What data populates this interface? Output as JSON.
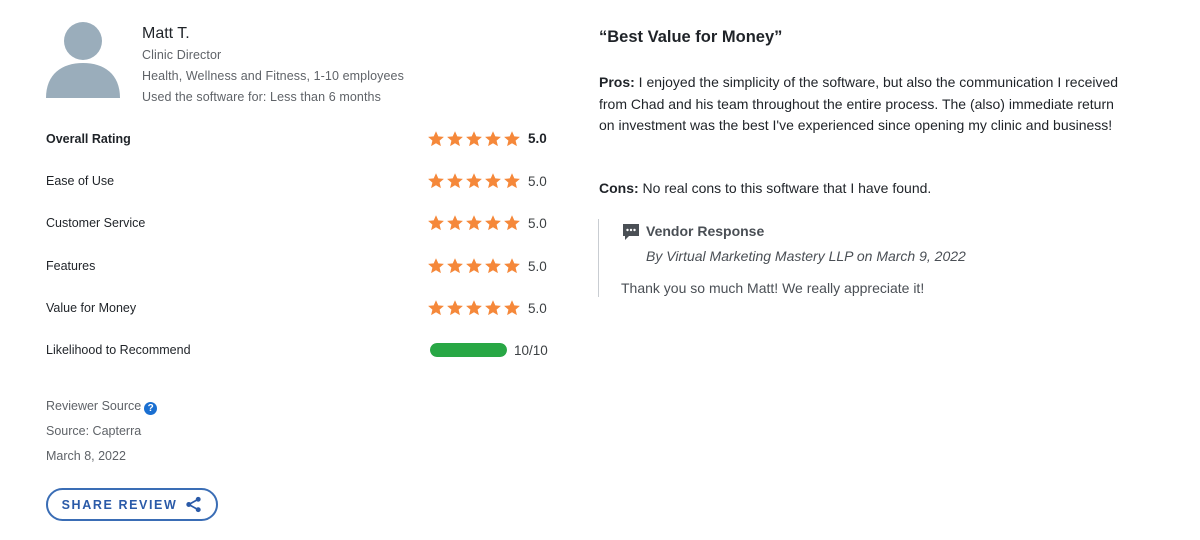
{
  "reviewer": {
    "name": "Matt T.",
    "role": "Clinic Director",
    "industry": "Health, Wellness and Fitness, 1-10 employees",
    "usage": "Used the software for: Less than 6 months"
  },
  "ratings": [
    {
      "label": "Overall Rating",
      "stars": 5,
      "value": "5.0"
    },
    {
      "label": "Ease of Use",
      "stars": 5,
      "value": "5.0"
    },
    {
      "label": "Customer Service",
      "stars": 5,
      "value": "5.0"
    },
    {
      "label": "Features",
      "stars": 5,
      "value": "5.0"
    },
    {
      "label": "Value for Money",
      "stars": 5,
      "value": "5.0"
    }
  ],
  "recommend": {
    "label": "Likelihood to Recommend",
    "value": "10/10",
    "fraction": 1.0
  },
  "source": {
    "label": "Reviewer Source",
    "help_icon": "question-circle-icon",
    "source": "Source: Capterra",
    "date": "March 8, 2022"
  },
  "share": {
    "label": "SHARE REVIEW",
    "icon": "share-icon"
  },
  "review": {
    "title": "“Best Value for Money”",
    "pros_label": "Pros:",
    "pros": " I enjoyed the simplicity of the software, but also the communication I received from Chad and his team throughout the entire process. The (also) immediate return on investment was the best I've experienced since opening my clinic and business!",
    "cons_label": "Cons:",
    "cons": " No real cons to this software that I have found."
  },
  "vendor": {
    "icon": "chat-bubble-icon",
    "title": "Vendor Response",
    "by": "By Virtual Marketing Mastery LLP on March 9, 2022",
    "text": "Thank you so much Matt! We really appreciate it!"
  },
  "colors": {
    "star": "#f5883a",
    "recommend_bar": "#28a745",
    "accent": "#2a5aa8"
  }
}
